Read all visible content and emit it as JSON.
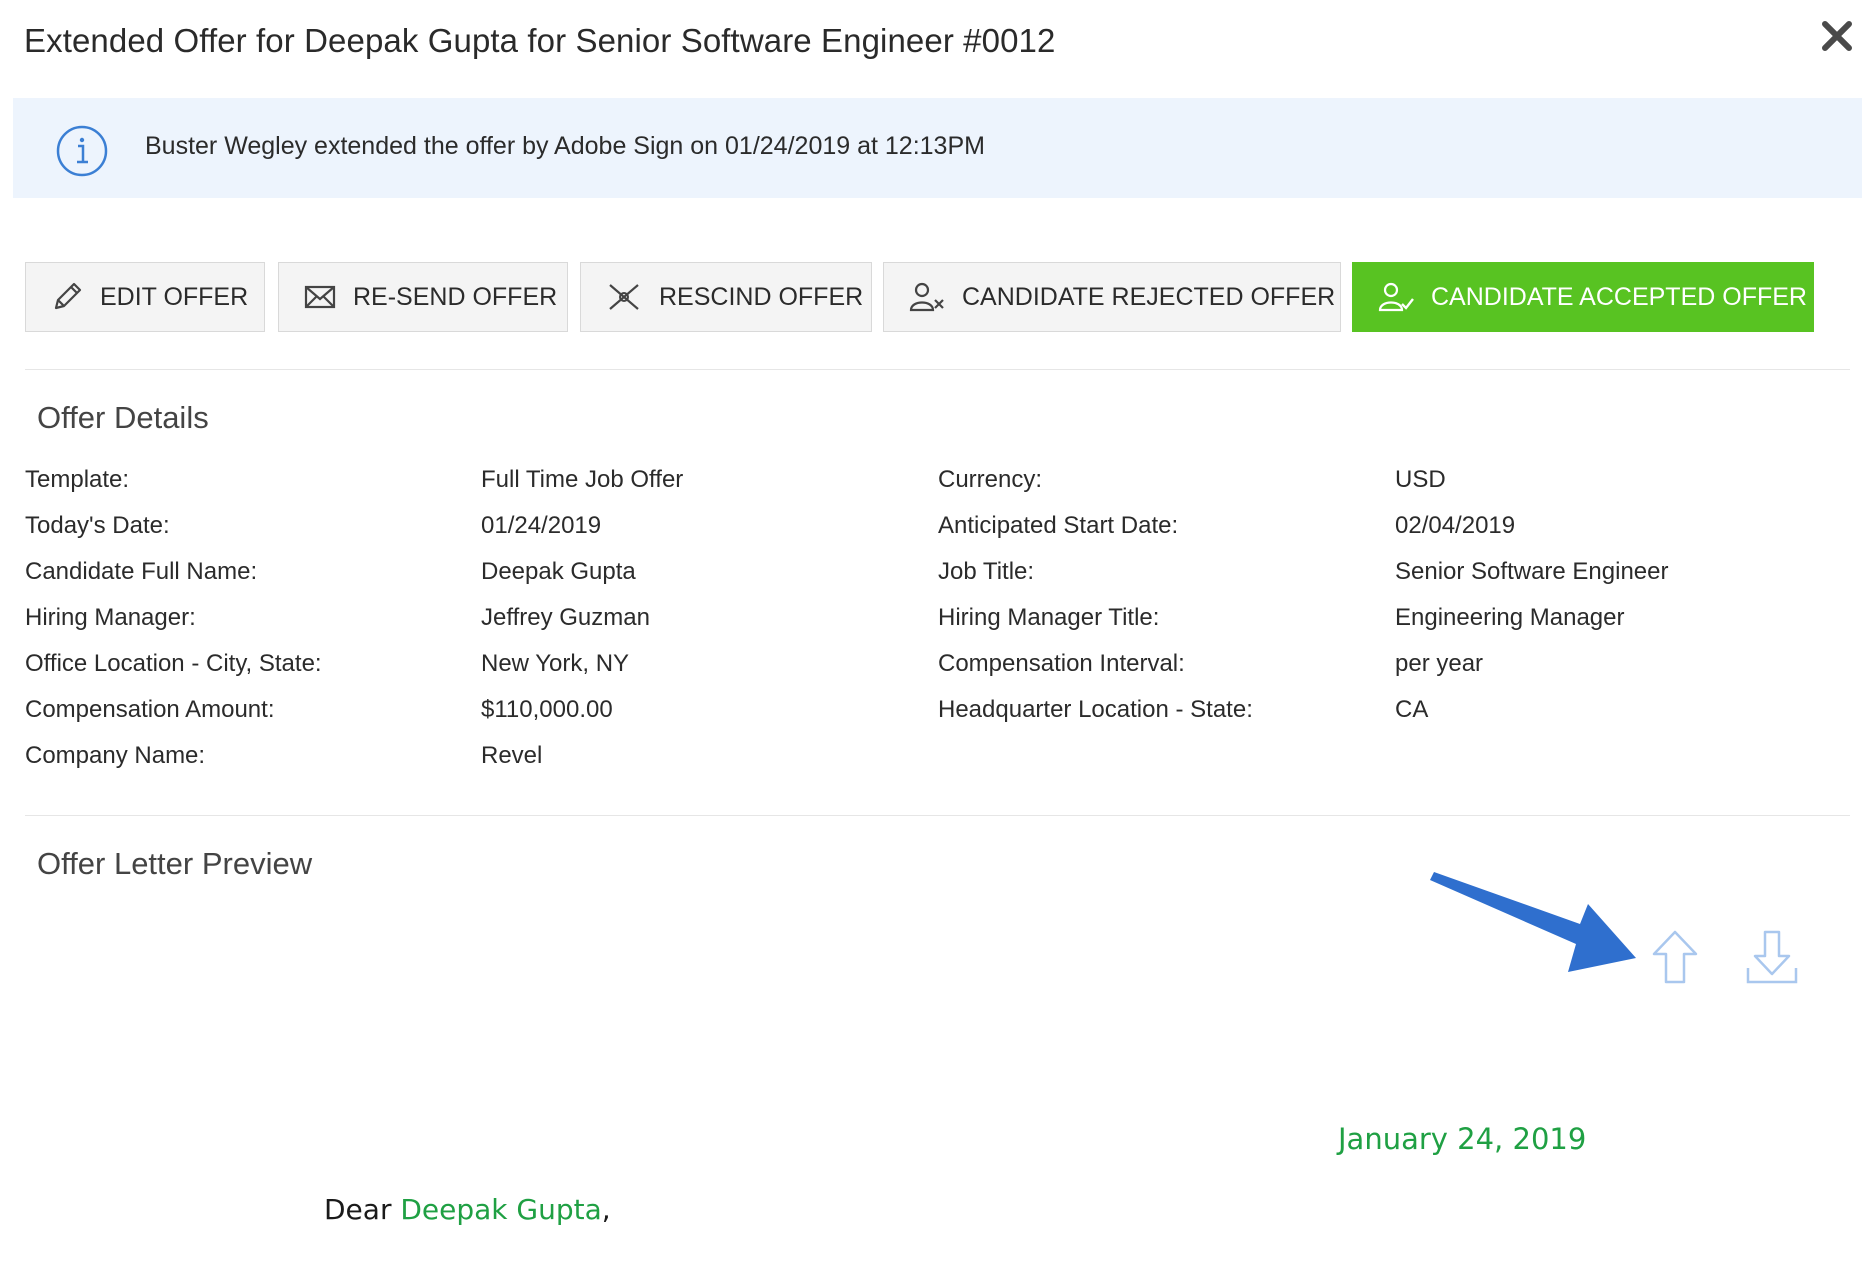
{
  "modal": {
    "title": "Extended Offer for Deepak Gupta for Senior Software Engineer #0012",
    "close_icon": "close-icon"
  },
  "banner": {
    "icon": "info-icon",
    "message": "Buster Wegley extended the offer by Adobe Sign on 01/24/2019 at 12:13PM"
  },
  "actions": [
    {
      "label": "EDIT OFFER",
      "icon": "pencil-icon"
    },
    {
      "label": "RE-SEND OFFER",
      "icon": "envelope-icon"
    },
    {
      "label": "RESCIND OFFER",
      "icon": "rescind-icon"
    },
    {
      "label": "CANDIDATE REJECTED OFFER",
      "icon": "rejected-icon"
    },
    {
      "label": "CANDIDATE ACCEPTED OFFER",
      "icon": "accepted-icon"
    }
  ],
  "offer_details": {
    "title": "Offer Details",
    "rows": [
      {
        "l1": "Template:",
        "v1": "Full Time Job Offer",
        "l2": "Currency:",
        "v2": "USD"
      },
      {
        "l1": "Today's Date:",
        "v1": "01/24/2019",
        "l2": "Anticipated Start Date:",
        "v2": "02/04/2019"
      },
      {
        "l1": "Candidate Full Name:",
        "v1": "Deepak Gupta",
        "l2": "Job Title:",
        "v2": "Senior Software Engineer"
      },
      {
        "l1": "Hiring Manager:",
        "v1": "Jeffrey Guzman",
        "l2": "Hiring Manager Title:",
        "v2": "Engineering Manager"
      },
      {
        "l1": "Office Location - City, State:",
        "v1": "New York, NY",
        "l2": "Compensation Interval:",
        "v2": "per year"
      },
      {
        "l1": "Compensation Amount:",
        "v1": "$110,000.00",
        "l2": "Headquarter Location - State:",
        "v2": "CA"
      },
      {
        "l1": "Company Name:",
        "v1": "Revel",
        "l2": "",
        "v2": ""
      }
    ]
  },
  "preview": {
    "title": "Offer Letter Preview",
    "upload_icon": "upload-icon",
    "download_icon": "download-icon",
    "date": "January 24, 2019",
    "greeting": "Dear ",
    "candidate_name": "Deepak Gupta",
    "greeting_end": ","
  },
  "colors": {
    "accent_green": "#58c322",
    "banner_bg": "#edf4fd",
    "info_blue": "#3b7fd4",
    "annotation_arrow": "#2f6fce",
    "letter_green": "#1fa043"
  }
}
